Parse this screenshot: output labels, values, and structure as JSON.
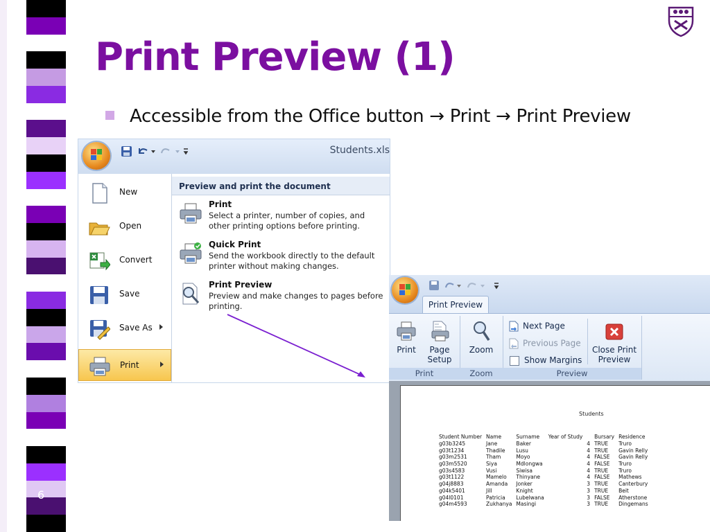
{
  "slide": {
    "title": "Print Preview (1)",
    "bullet": "Accessible from the Office button → Print → Print Preview",
    "number": "6",
    "colors": {
      "title": "#7b0fa0",
      "bullet": "#d2a8e6"
    },
    "stripes": [
      "#000000",
      "#7a00b5",
      "#ffffff",
      "#000000",
      "#c59be3",
      "#8a2be2",
      "#ffffff",
      "#5b0f8c",
      "#e8d2f7",
      "#000000",
      "#9b30ff",
      "#ffffff",
      "#7a00b5",
      "#000000",
      "#d7b4f0",
      "#4a1070",
      "#ffffff",
      "#8a2be2",
      "#000000",
      "#caa6ea",
      "#6a0dad",
      "#ffffff",
      "#000000",
      "#b080e0",
      "#7a00b5",
      "#ffffff",
      "#000000",
      "#9b30ff",
      "#e0c8f4",
      "#4a1070",
      "#000000"
    ]
  },
  "office_menu": {
    "doc_title": "Students.xls",
    "items": [
      {
        "label": "New",
        "icon": "new-document-icon"
      },
      {
        "label": "Open",
        "icon": "open-folder-icon"
      },
      {
        "label": "Convert",
        "icon": "convert-excel-icon"
      },
      {
        "label": "Save",
        "icon": "save-disk-icon"
      },
      {
        "label": "Save As",
        "icon": "save-as-icon"
      },
      {
        "label": "Print",
        "icon": "printer-icon"
      }
    ],
    "submenu_title": "Preview and print the document",
    "submenu": [
      {
        "title": "Print",
        "desc": "Select a printer, number of copies, and other printing options before printing.",
        "icon": "printer-icon"
      },
      {
        "title": "Quick Print",
        "desc": "Send the workbook directly to the default printer without making changes.",
        "icon": "quick-print-icon"
      },
      {
        "title": "Print Preview",
        "desc": "Preview and make changes to pages before printing.",
        "icon": "magnifier-page-icon"
      }
    ]
  },
  "ribbon": {
    "tab": "Print Preview",
    "groups": {
      "print": "Print",
      "zoom": "Zoom",
      "preview": "Preview"
    },
    "buttons": {
      "print": "Print",
      "page_setup_1": "Page",
      "page_setup_2": "Setup",
      "zoom": "Zoom",
      "next_page": "Next Page",
      "previous_page": "Previous Page",
      "show_margins": "Show Margins",
      "close_1": "Close Print",
      "close_2": "Preview"
    }
  },
  "sheet": {
    "title": "Students",
    "headers": [
      "Student Number",
      "Name",
      "Surname",
      "Year of Study",
      "",
      "Bursary",
      "Residence"
    ],
    "rows": [
      [
        "g03b3245",
        "Jane",
        "Baker",
        "",
        "4",
        "TRUE",
        "Truro"
      ],
      [
        "g03t1234",
        "Thadile",
        "Lusu",
        "",
        "4",
        "TRUE",
        "Gavin Relly"
      ],
      [
        "g03m2531",
        "Tham",
        "Moyo",
        "",
        "4",
        "FALSE",
        "Gavin Relly"
      ],
      [
        "g03m5520",
        "Siya",
        "Mdlongwa",
        "",
        "4",
        "FALSE",
        "Truro"
      ],
      [
        "g03s4583",
        "Vusi",
        "Siwisa",
        "",
        "4",
        "TRUE",
        "Truro"
      ],
      [
        "g03t1122",
        "Mamelo",
        "Thinyane",
        "",
        "4",
        "FALSE",
        "Mathews"
      ],
      [
        "g04j8883",
        "Amanda",
        "Jonker",
        "",
        "3",
        "TRUE",
        "Canterbury"
      ],
      [
        "g04k5401",
        "Jill",
        "Knight",
        "",
        "3",
        "TRUE",
        "Beit"
      ],
      [
        "g04l0101",
        "Patricia",
        "Lubelwana",
        "",
        "3",
        "FALSE",
        "Atherstone"
      ],
      [
        "g04m4593",
        "Zukhanya",
        "Masingi",
        "",
        "3",
        "TRUE",
        "Dingemans"
      ]
    ]
  }
}
